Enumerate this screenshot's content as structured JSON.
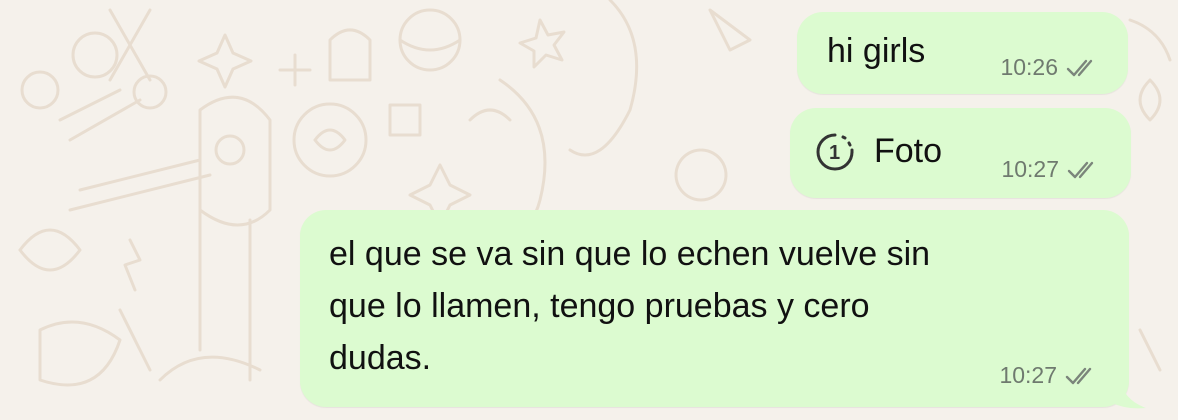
{
  "chat": {
    "messages": [
      {
        "text": "hi girls",
        "time": "10:26",
        "status": "read-double-check-icon"
      },
      {
        "media_label": "Foto",
        "view_once_count": "1",
        "time": "10:27",
        "status": "read-double-check-icon"
      },
      {
        "lines": [
          "el que se va sin que lo echen vuelve sin",
          "que lo llamen, tengo pruebas y cero",
          "dudas."
        ],
        "time": "10:27",
        "status": "read-double-check-icon"
      }
    ]
  },
  "colors": {
    "wallpaper": "#f5f1eb",
    "outgoing_bubble": "#dcfbd0",
    "timestamp": "#6f7a6f"
  }
}
